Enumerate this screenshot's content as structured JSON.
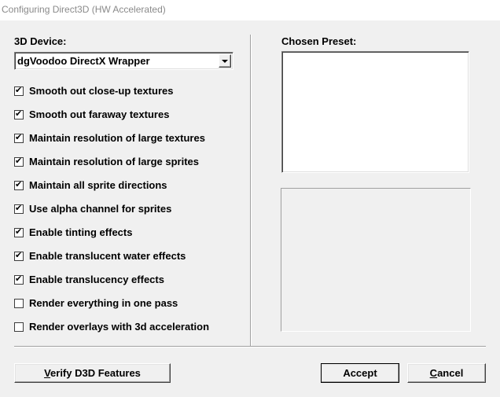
{
  "window": {
    "title": "Configuring Direct3D (HW Accelerated)"
  },
  "device": {
    "label": "3D Device:",
    "selected": "dgVoodoo DirectX Wrapper"
  },
  "options": [
    {
      "label": "Smooth out close-up textures",
      "checked": true
    },
    {
      "label": "Smooth out faraway textures",
      "checked": true
    },
    {
      "label": "Maintain resolution of large textures",
      "checked": true
    },
    {
      "label": "Maintain resolution of large sprites",
      "checked": true
    },
    {
      "label": "Maintain all sprite directions",
      "checked": true
    },
    {
      "label": "Use alpha channel for sprites",
      "checked": true
    },
    {
      "label": "Enable tinting effects",
      "checked": true
    },
    {
      "label": "Enable translucent water effects",
      "checked": true
    },
    {
      "label": "Enable translucency effects",
      "checked": true
    },
    {
      "label": "Render everything in one pass",
      "checked": false
    },
    {
      "label": "Render overlays with 3d acceleration",
      "checked": false
    }
  ],
  "preset": {
    "label": "Chosen Preset:"
  },
  "buttons": {
    "verify": {
      "mnemonic": "V",
      "rest": "erify D3D Features"
    },
    "accept": "Accept",
    "cancel": {
      "mnemonic": "C",
      "rest": "ancel"
    }
  },
  "colors": {
    "face": "#f0f0f0",
    "title_text": "#8a8a8a"
  }
}
